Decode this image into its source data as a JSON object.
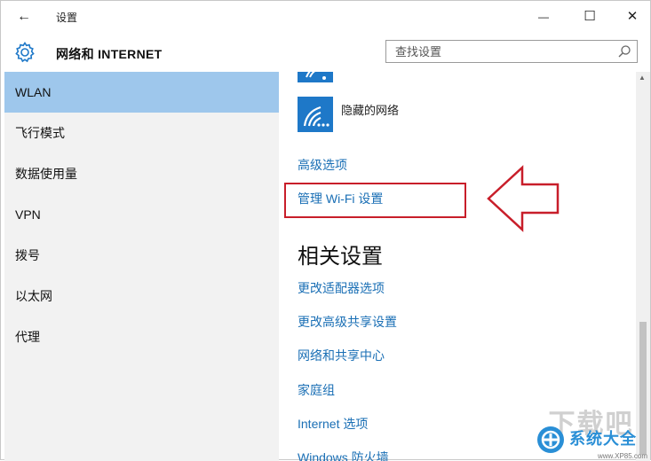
{
  "window": {
    "back_glyph": "←",
    "title": "设置",
    "minimize_glyph": "—",
    "maximize_glyph": "☐",
    "close_glyph": "✕"
  },
  "header": {
    "section_title": "网络和 INTERNET",
    "section_icon": "gear-icon",
    "search_placeholder": "查找设置",
    "search_icon": "search-icon"
  },
  "sidebar": {
    "items": [
      {
        "label": "WLAN",
        "active": true
      },
      {
        "label": "飞行模式",
        "active": false
      },
      {
        "label": "数据使用量",
        "active": false
      },
      {
        "label": "VPN",
        "active": false
      },
      {
        "label": "拨号",
        "active": false
      },
      {
        "label": "以太网",
        "active": false
      },
      {
        "label": "代理",
        "active": false
      }
    ]
  },
  "main": {
    "network_icon": "wifi-icon",
    "hidden_network_label": "隐藏的网络",
    "advanced_options_link": "高级选项",
    "manage_wifi_link": "管理 Wi-Fi 设置",
    "related_settings_heading": "相关设置",
    "related_links": [
      "更改适配器选项",
      "更改高级共享设置",
      "网络和共享中心",
      "家庭组",
      "Internet 选项",
      "Windows 防火墙"
    ]
  },
  "annotation": {
    "highlight_color": "#c81e2a",
    "arrow_icon": "left-arrow-icon"
  },
  "watermark": {
    "top_text": "下载吧",
    "brand": "系统大全",
    "url": "www.XP85.com"
  },
  "colors": {
    "accent": "#1e78c8",
    "link": "#1a6fb5",
    "nav_active": "#9ec7ec",
    "sidebar_bg": "#f2f2f2"
  }
}
